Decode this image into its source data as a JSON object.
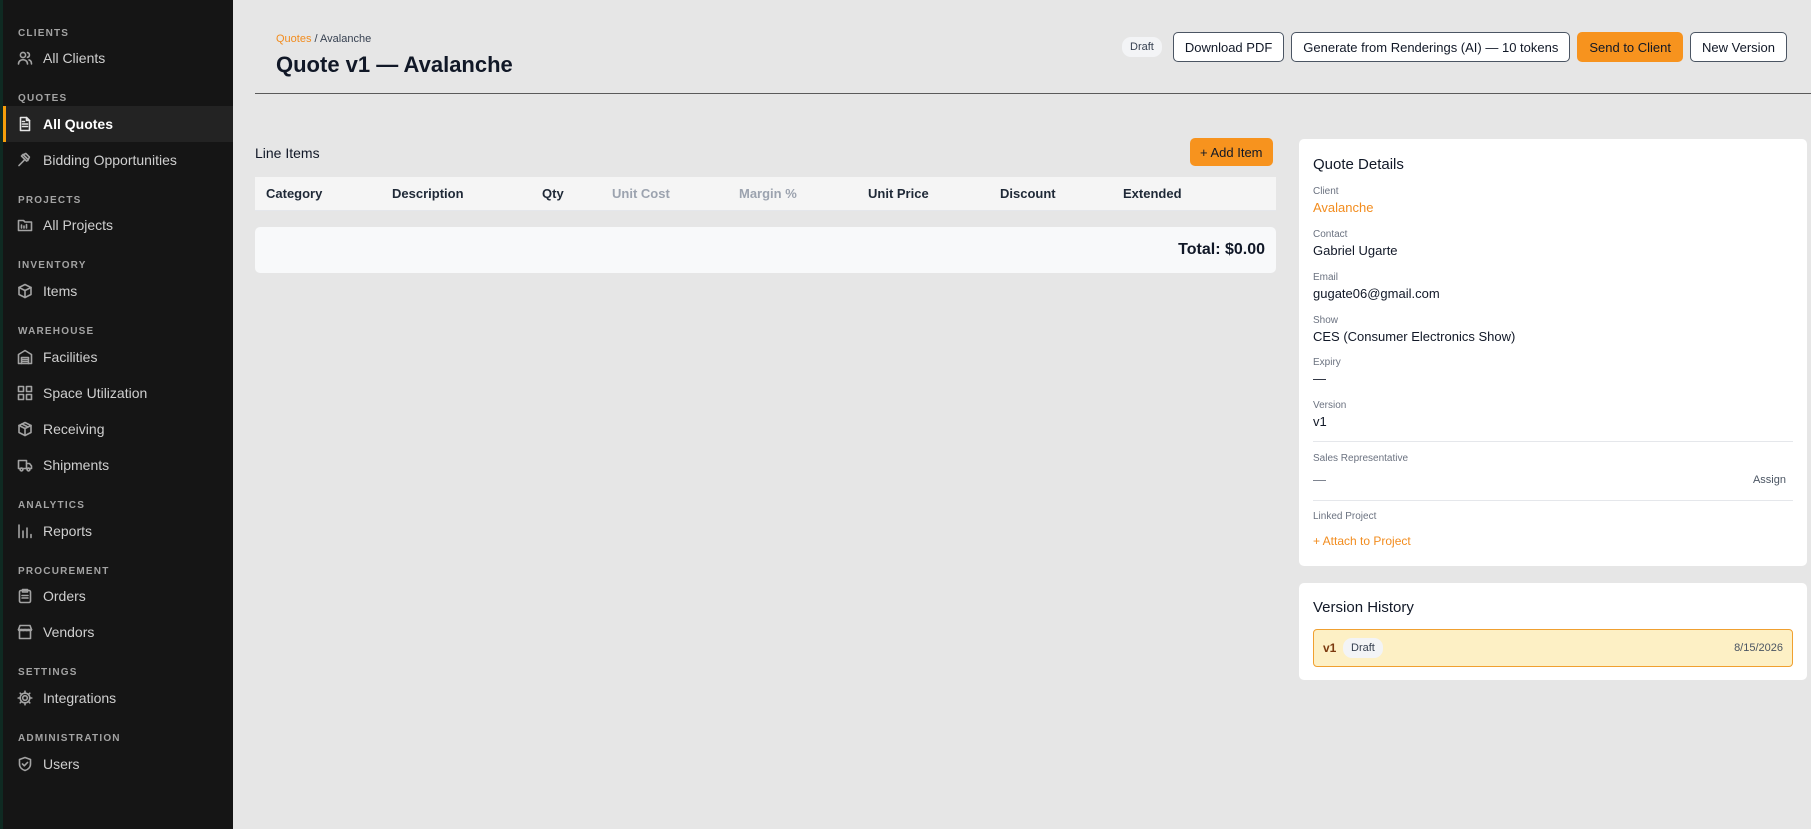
{
  "sidebar": {
    "sections": [
      {
        "label": "CLIENTS",
        "items": [
          {
            "label": "All Clients",
            "icon": "users-icon"
          }
        ]
      },
      {
        "label": "QUOTES",
        "items": [
          {
            "label": "All Quotes",
            "icon": "document-icon",
            "active": true
          },
          {
            "label": "Bidding Opportunities",
            "icon": "gavel-icon"
          }
        ]
      },
      {
        "label": "PROJECTS",
        "items": [
          {
            "label": "All Projects",
            "icon": "folder-icon"
          }
        ]
      },
      {
        "label": "INVENTORY",
        "items": [
          {
            "label": "Items",
            "icon": "box-icon"
          }
        ]
      },
      {
        "label": "WAREHOUSE",
        "items": [
          {
            "label": "Facilities",
            "icon": "building-icon"
          },
          {
            "label": "Space Utilization",
            "icon": "grid-icon"
          },
          {
            "label": "Receiving",
            "icon": "package-icon"
          },
          {
            "label": "Shipments",
            "icon": "truck-icon"
          }
        ]
      },
      {
        "label": "ANALYTICS",
        "items": [
          {
            "label": "Reports",
            "icon": "bar-chart-icon"
          }
        ]
      },
      {
        "label": "PROCUREMENT",
        "items": [
          {
            "label": "Orders",
            "icon": "clipboard-icon"
          },
          {
            "label": "Vendors",
            "icon": "store-icon"
          }
        ]
      },
      {
        "label": "SETTINGS",
        "items": [
          {
            "label": "Integrations",
            "icon": "gear-icon"
          }
        ]
      },
      {
        "label": "ADMINISTRATION",
        "items": [
          {
            "label": "Users",
            "icon": "shield-icon"
          }
        ]
      }
    ]
  },
  "header": {
    "breadcrumb_link": "Quotes",
    "breadcrumb_sep": "/",
    "breadcrumb_current": "Avalanche",
    "title": "Quote v1 — Avalanche",
    "status_badge": "Draft",
    "buttons": {
      "download_pdf": "Download PDF",
      "generate": "Generate from Renderings (AI) — 10 tokens",
      "send": "Send to Client",
      "new_version": "New Version"
    }
  },
  "line_items": {
    "title": "Line Items",
    "add_button": "+ Add Item",
    "columns": [
      "Category",
      "Description",
      "Qty",
      "Unit Cost",
      "Margin %",
      "Unit Price",
      "Discount",
      "Extended"
    ],
    "rows": [],
    "total": "Total: $0.00"
  },
  "quote_details": {
    "title": "Quote Details",
    "client_label": "Client",
    "client": "Avalanche",
    "contact_label": "Contact",
    "contact": "Gabriel Ugarte",
    "email_label": "Email",
    "email": "gugate06@gmail.com",
    "show_label": "Show",
    "show": "CES (Consumer Electronics Show)",
    "expiry_label": "Expiry",
    "expiry": "—",
    "version_label": "Version",
    "version": "v1",
    "sales_rep_label": "Sales Representative",
    "sales_rep": "—",
    "assign": "Assign",
    "linked_project_label": "Linked Project",
    "attach": "+ Attach to Project"
  },
  "version_history": {
    "title": "Version History",
    "versions": [
      {
        "version": "v1",
        "status": "Draft",
        "date": "8/15/2026"
      }
    ]
  },
  "colors": {
    "accent": "#f7931e",
    "sidebar_bg": "#151515",
    "page_bg": "#e6e6e6"
  }
}
